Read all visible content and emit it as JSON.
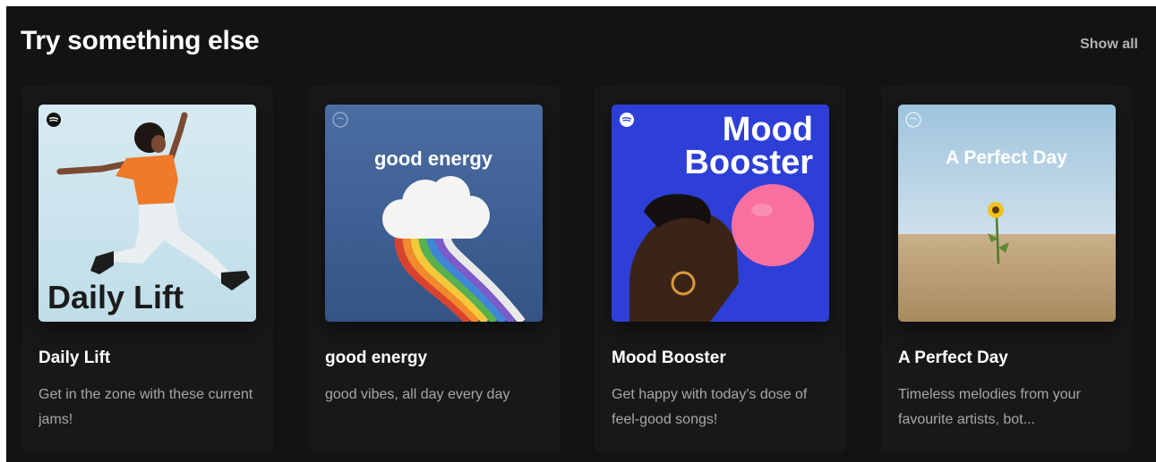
{
  "section": {
    "title": "Try something else",
    "show_all_label": "Show all"
  },
  "colors": {
    "background": "#131313",
    "card": "#181818",
    "title_text": "#ffffff",
    "subtext": "#a7a7a7",
    "mood_booster_blue": "#2d3fd6",
    "good_energy_blue": "#3b5b8f"
  },
  "cards": [
    {
      "title": "Daily Lift",
      "description": "Get in the zone with these current jams!",
      "cover_text": "Daily Lift",
      "cover_icon": "spotify-icon"
    },
    {
      "title": "good energy",
      "description": "good vibes, all day every day",
      "cover_text": "good energy",
      "cover_icon": "spotify-icon"
    },
    {
      "title": "Mood Booster",
      "description": "Get happy with today's dose of feel-good songs!",
      "cover_text_line1": "Mood",
      "cover_text_line2": "Booster",
      "cover_icon": "spotify-icon"
    },
    {
      "title": "A Perfect Day",
      "description": "Timeless melodies from your favourite artists, bot...",
      "cover_text": "A Perfect Day",
      "cover_icon": "spotify-icon"
    }
  ]
}
